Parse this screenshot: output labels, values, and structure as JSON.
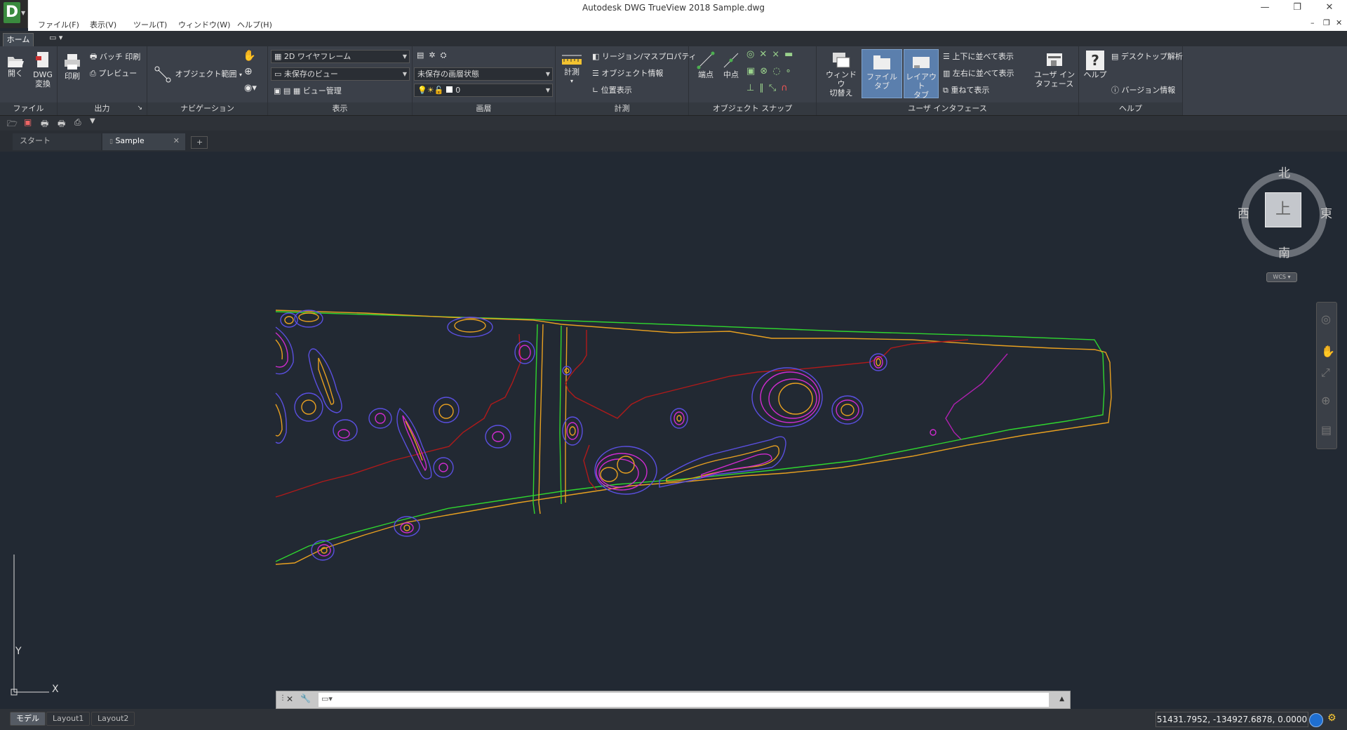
{
  "window": {
    "title": "Autodesk DWG TrueView 2018    Sample.dwg",
    "minimize": "—",
    "restore": "❐",
    "close": "✕",
    "logo_letter": "D"
  },
  "menu": {
    "items": [
      "ファイル(F)",
      "表示(V)",
      "ツール(T)",
      "ウィンドウ(W)",
      "ヘルプ(H)"
    ]
  },
  "ribbon_tabs": {
    "home": "ホーム",
    "extra": "▭ ▾"
  },
  "ribbon": {
    "file_panel": {
      "title": "ファイル",
      "open": "開く",
      "dwg_convert_1": "DWG",
      "dwg_convert_2": "変換"
    },
    "output_panel": {
      "title": "出力",
      "print": "印刷",
      "batch_print": "バッチ 印刷",
      "preview": "プレビュー"
    },
    "navigation_panel": {
      "title": "ナビゲーション",
      "extents": "オブジェクト範囲"
    },
    "display_panel": {
      "title": "表示",
      "visual_style": "2D ワイヤフレーム",
      "saved_view": "未保存のビュー",
      "view_manager": "ビュー管理"
    },
    "layer_panel": {
      "title": "画層",
      "layer_state": "未保存の画層状態",
      "current_layer": "0"
    },
    "measure_panel": {
      "title": "計測",
      "measure": "計測",
      "region_mass": "リージョン/マスプロパティ",
      "object_info": "オブジェクト情報",
      "locate": "位置表示"
    },
    "osnap_panel": {
      "title": "オブジェクト スナップ",
      "endpoint": "端点",
      "midpoint": "中点"
    },
    "ui_panel": {
      "title": "ユーザ インタフェース",
      "switch_window_1": "ウィンドウ",
      "switch_window_2": "切替え",
      "file_tab": "ファイル タブ",
      "layout_tab_1": "レイアウト",
      "layout_tab_2": "タブ",
      "tile_h": "上下に並べて表示",
      "tile_v": "左右に並べて表示",
      "cascade": "重ねて表示",
      "user_interface_1": "ユーザ イン",
      "user_interface_2": "タフェース"
    },
    "help_panel": {
      "title": "ヘルプ",
      "help": "ヘルプ",
      "desktop_analytics": "デスクトップ解析",
      "version_info": "バージョン情報"
    }
  },
  "doc_tabs": {
    "start": "スタート",
    "sample": "Sample",
    "add": "+"
  },
  "viewcube": {
    "north": "北",
    "south": "南",
    "east": "東",
    "west": "西",
    "top": "上",
    "wcs": "WCS"
  },
  "ucs": {
    "x": "X",
    "y": "Y"
  },
  "layout_tabs": [
    "モデル",
    "Layout1",
    "Layout2"
  ],
  "status": {
    "coordinates": "51431.7952, -134927.6878, 0.0000"
  },
  "colors": {
    "green": "#2fd62f",
    "orange": "#e8a020",
    "red": "#b01a1a",
    "blue": "#5a4fe0",
    "magenta": "#d02bd0",
    "canvas": "#222933"
  }
}
